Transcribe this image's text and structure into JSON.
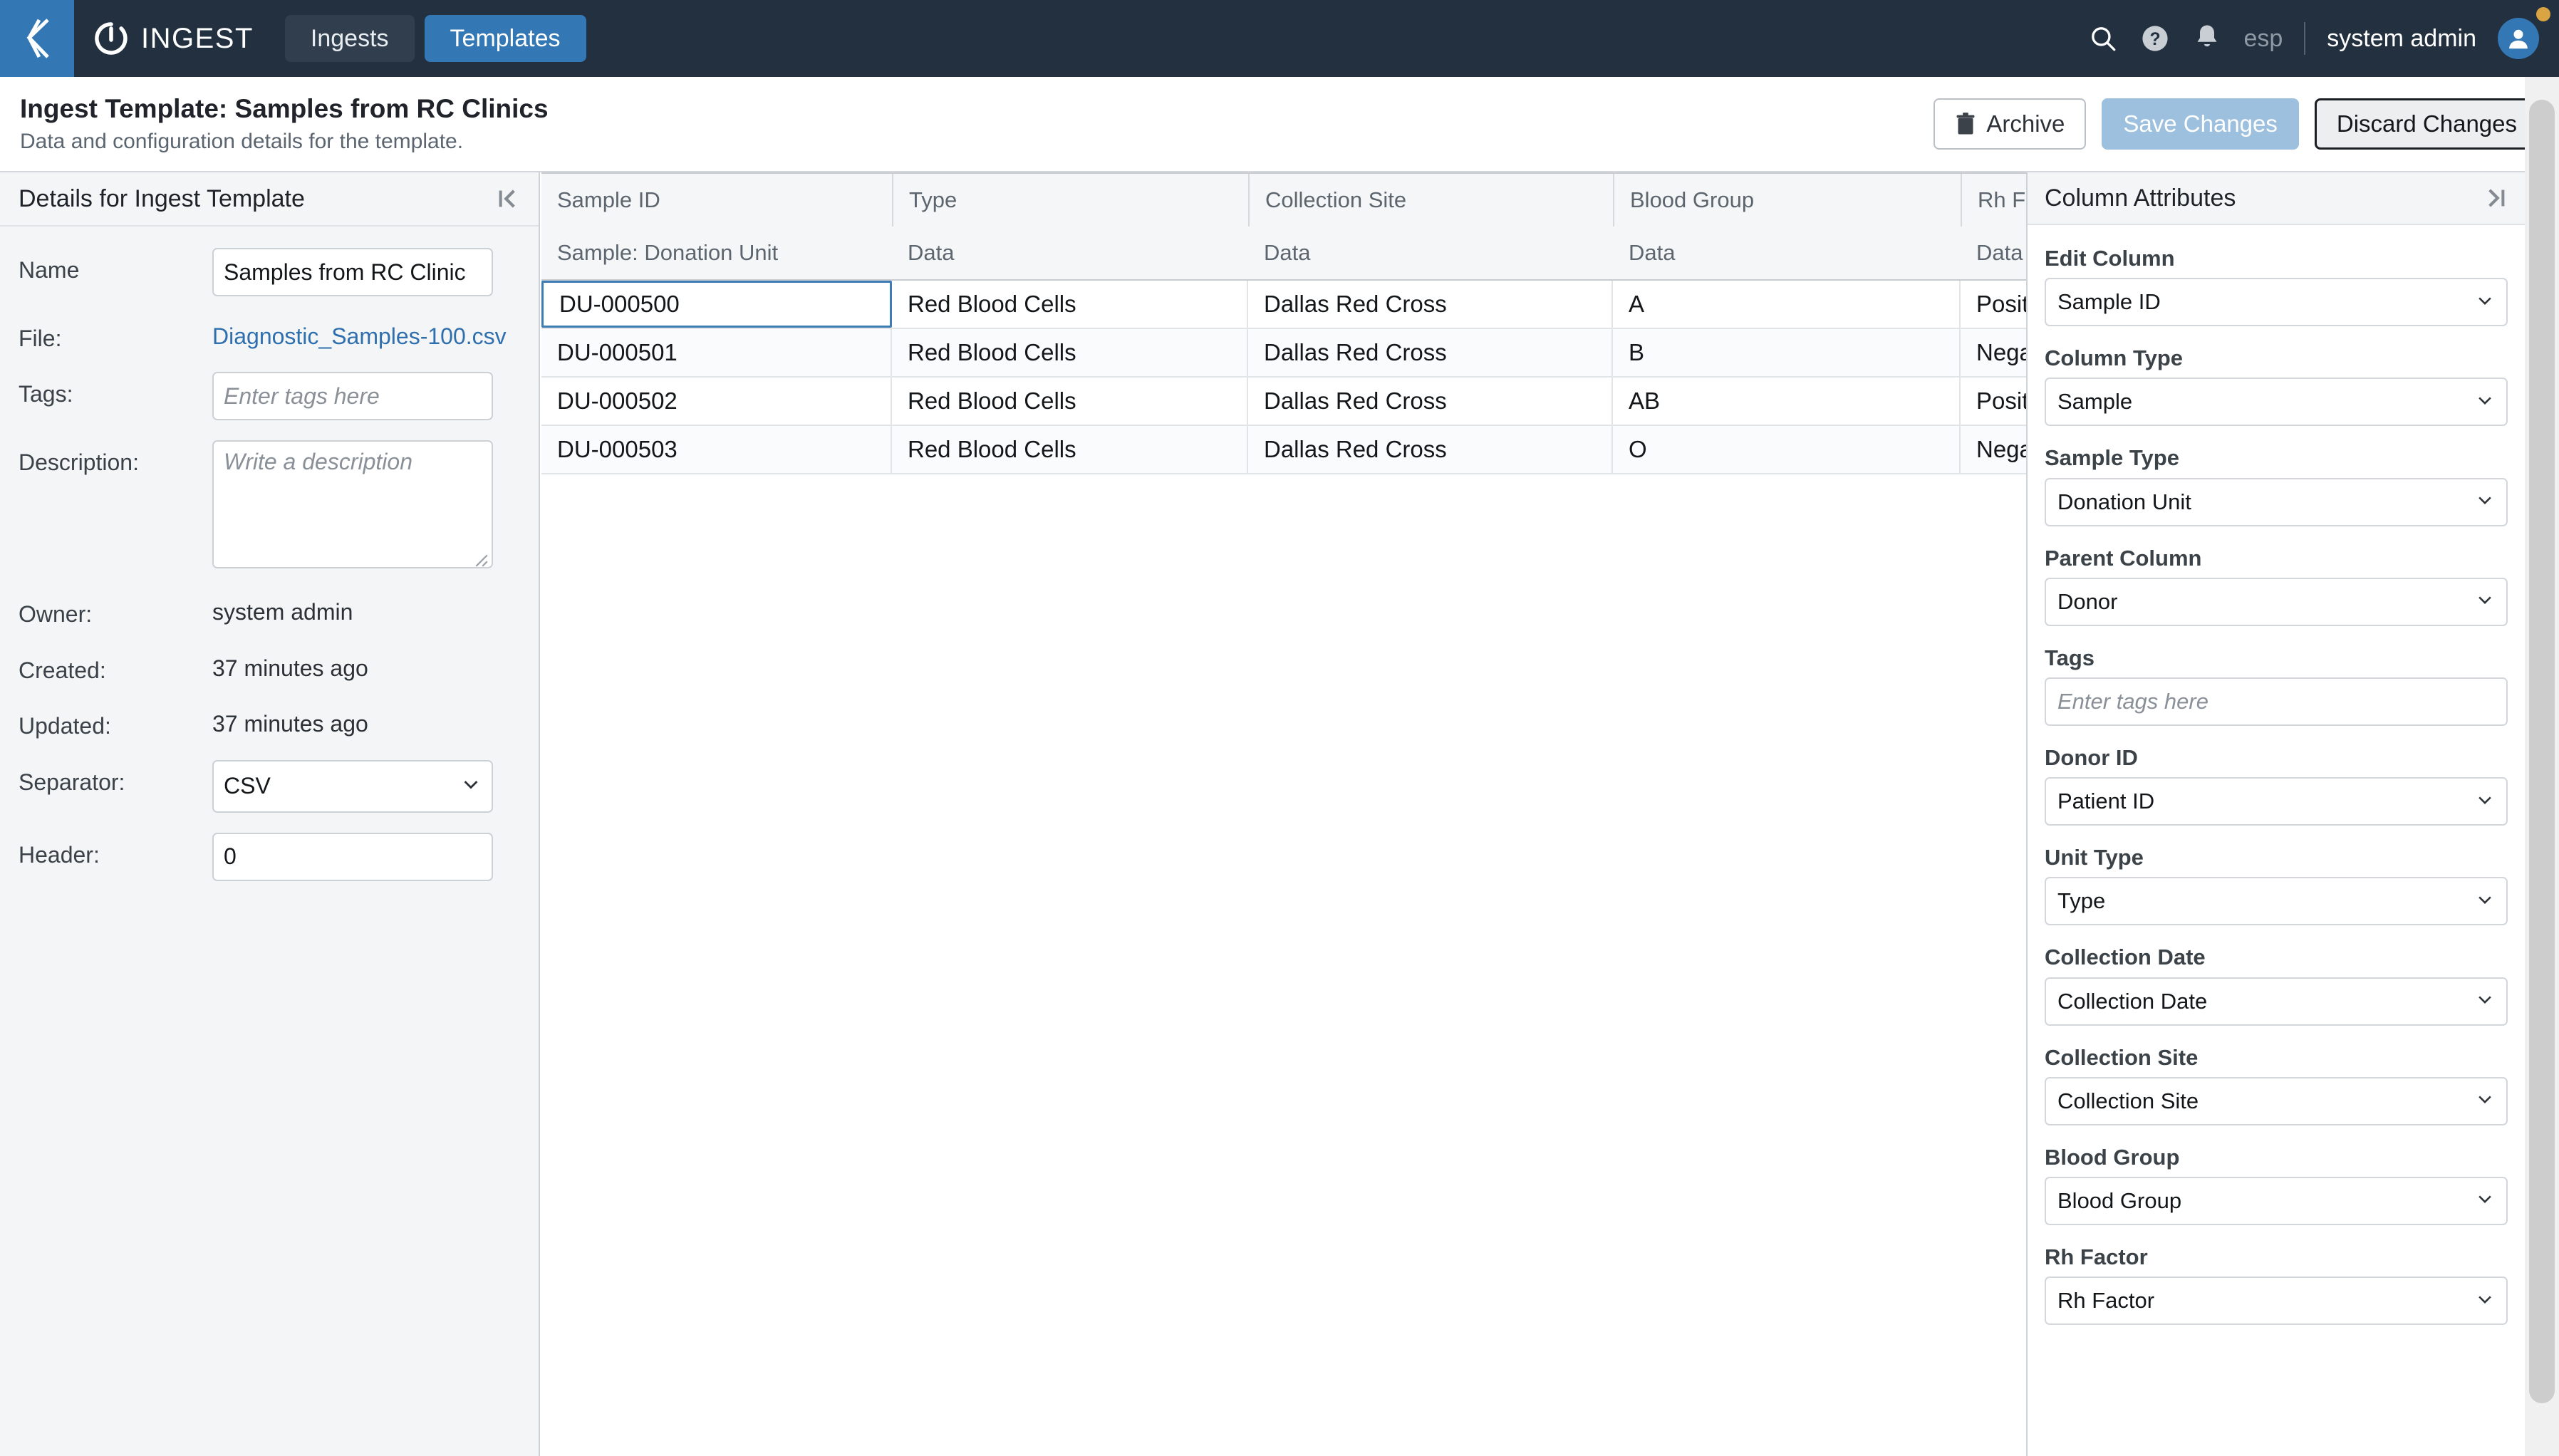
{
  "topnav": {
    "collapse_icon": "chevron-left-double-icon",
    "brand_icon": "ingest-ring-logo",
    "brand_name": "INGEST",
    "tabs": [
      {
        "label": "Ingests",
        "active": false
      },
      {
        "label": "Templates",
        "active": true
      }
    ],
    "search_icon": "search-icon",
    "help_icon": "help-circle-icon",
    "bell_icon": "bell-icon",
    "language": "esp",
    "username": "system admin",
    "avatar_icon": "user-avatar-icon",
    "accent_blue": "#3377b5",
    "nav_background": "#22303f"
  },
  "subheader": {
    "title": "Ingest Template: Samples from RC Clinics",
    "subtitle": "Data and configuration details for the template.",
    "archive_label": "Archive",
    "archive_icon": "trash-icon",
    "save_label": "Save Changes",
    "discard_label": "Discard Changes",
    "save_color": "#9cc0de"
  },
  "details_panel": {
    "header": "Details for Ingest Template",
    "collapse_icon": "collapse-left-icon",
    "fields": {
      "name_label": "Name",
      "name_value": "Samples from RC Clinic",
      "file_label": "File:",
      "file_value": "Diagnostic_Samples-100.csv",
      "tags_label": "Tags:",
      "tags_placeholder": "Enter tags here",
      "tags_value": "",
      "description_label": "Description:",
      "description_placeholder": "Write a description",
      "description_value": "",
      "owner_label": "Owner:",
      "owner_value": "system admin",
      "created_label": "Created:",
      "created_value": "37 minutes ago",
      "updated_label": "Updated:",
      "updated_value": "37 minutes ago",
      "separator_label": "Separator:",
      "separator_value": "CSV",
      "header_label": "Header:",
      "header_value": "0"
    }
  },
  "grid": {
    "columns": [
      {
        "name": "Sample ID",
        "subtype": "Sample: Donation Unit"
      },
      {
        "name": "Type",
        "subtype": "Data"
      },
      {
        "name": "Collection Site",
        "subtype": "Data"
      },
      {
        "name": "Blood Group",
        "subtype": "Data"
      },
      {
        "name": "Rh Factor",
        "subtype": "Data"
      }
    ],
    "rows": [
      {
        "sample_id": "DU-000500",
        "type": "Red Blood Cells",
        "collection_site": "Dallas Red Cross",
        "blood_group": "A",
        "rh_factor": "Positive"
      },
      {
        "sample_id": "DU-000501",
        "type": "Red Blood Cells",
        "collection_site": "Dallas Red Cross",
        "blood_group": "B",
        "rh_factor": "Negative"
      },
      {
        "sample_id": "DU-000502",
        "type": "Red Blood Cells",
        "collection_site": "Dallas Red Cross",
        "blood_group": "AB",
        "rh_factor": "Positive"
      },
      {
        "sample_id": "DU-000503",
        "type": "Red Blood Cells",
        "collection_site": "Dallas Red Cross",
        "blood_group": "O",
        "rh_factor": "Negative"
      }
    ],
    "selected_cell": {
      "row": 0,
      "column": "sample_id"
    },
    "selection_border_color": "#3f7cb4"
  },
  "column_attributes": {
    "header": "Column Attributes",
    "collapse_icon": "collapse-right-icon",
    "groups": [
      {
        "label": "Edit Column",
        "value": "Sample ID",
        "control": "select"
      },
      {
        "label": "Column Type",
        "value": "Sample",
        "control": "select"
      },
      {
        "label": "Sample Type",
        "value": "Donation Unit",
        "control": "select"
      },
      {
        "label": "Parent Column",
        "value": "Donor",
        "control": "select"
      },
      {
        "label": "Tags",
        "value": "",
        "control": "input",
        "placeholder": "Enter tags here"
      },
      {
        "label": "Donor ID",
        "value": "Patient ID",
        "control": "select"
      },
      {
        "label": "Unit Type",
        "value": "Type",
        "control": "select"
      },
      {
        "label": "Collection Date",
        "value": "Collection Date",
        "control": "select"
      },
      {
        "label": "Collection Site",
        "value": "Collection Site",
        "control": "select"
      },
      {
        "label": "Blood Group",
        "value": "Blood Group",
        "control": "select"
      },
      {
        "label": "Rh Factor",
        "value": "Rh Factor",
        "control": "select"
      }
    ]
  }
}
